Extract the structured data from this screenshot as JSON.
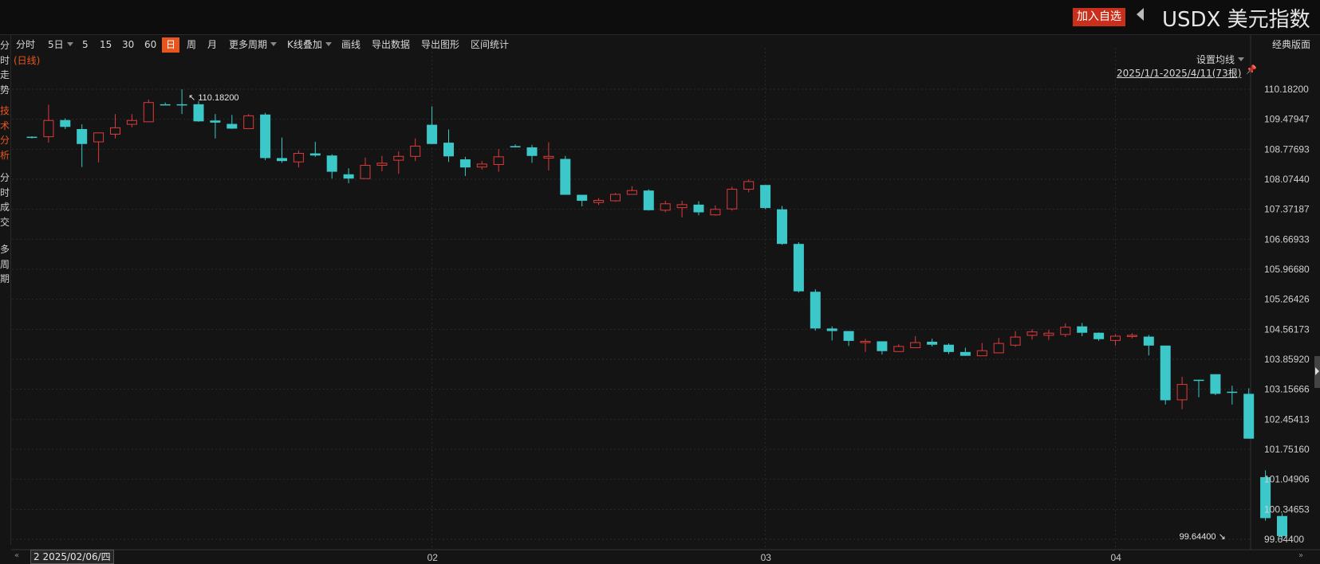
{
  "header": {
    "add_watchlist": "加入自选",
    "title": "USDX 美元指数"
  },
  "toolbar": {
    "items": [
      "分时",
      "5日",
      "5",
      "15",
      "30",
      "60",
      "日",
      "周",
      "月",
      "更多周期",
      "K线叠加",
      "画线",
      "导出数据",
      "导出图形",
      "区间统计"
    ],
    "active": "日",
    "classic_layout": "经典版面"
  },
  "sidebar": {
    "items": [
      "分时走势",
      "技术分析",
      "分时成交",
      "多周期"
    ],
    "active": "技术分析"
  },
  "chart_panel": {
    "period_label": "(日线)",
    "ma_setting": "设置均线",
    "date_range": "2025/1/1-2025/4/11(73根)",
    "date_tooltip": "2 2025/02/06/四",
    "nav_prev": "«",
    "nav_next": "»"
  },
  "colors": {
    "up": "#e03a3a",
    "down": "#3cc8c8",
    "grid": "#2b2b2b",
    "accent": "#e8561e",
    "background": "#141414"
  },
  "chart_data": {
    "type": "candlestick",
    "y_ticks": [
      "110.18200",
      "109.47947",
      "108.77693",
      "108.07440",
      "107.37187",
      "106.66933",
      "105.96680",
      "105.26426",
      "104.56173",
      "103.85920",
      "103.15666",
      "102.45413",
      "101.75160",
      "101.04906",
      "100.34653",
      "99.64400"
    ],
    "ylim": [
      99.644,
      110.182
    ],
    "x_labels": [
      {
        "index": 24,
        "label": "02"
      },
      {
        "index": 44,
        "label": "03"
      },
      {
        "index": 65,
        "label": "04"
      }
    ],
    "max_label": "110.18200",
    "max_index": 9,
    "min_label": "99.64400",
    "min_index": 72,
    "candles": [
      {
        "o": 109.07,
        "h": 109.08,
        "l": 109.03,
        "c": 109.05
      },
      {
        "o": 109.07,
        "h": 109.82,
        "l": 108.93,
        "c": 109.45
      },
      {
        "o": 109.46,
        "h": 109.5,
        "l": 109.25,
        "c": 109.3
      },
      {
        "o": 109.25,
        "h": 109.36,
        "l": 108.36,
        "c": 108.9
      },
      {
        "o": 108.95,
        "h": 109.11,
        "l": 108.47,
        "c": 109.16
      },
      {
        "o": 109.13,
        "h": 109.6,
        "l": 109.03,
        "c": 109.28
      },
      {
        "o": 109.36,
        "h": 109.6,
        "l": 109.29,
        "c": 109.45
      },
      {
        "o": 109.42,
        "h": 109.94,
        "l": 109.42,
        "c": 109.87
      },
      {
        "o": 109.83,
        "h": 109.87,
        "l": 109.83,
        "c": 109.83
      },
      {
        "o": 109.83,
        "h": 110.18,
        "l": 109.6,
        "c": 109.83
      },
      {
        "o": 109.83,
        "h": 109.9,
        "l": 109.42,
        "c": 109.43
      },
      {
        "o": 109.45,
        "h": 109.6,
        "l": 109.03,
        "c": 109.4
      },
      {
        "o": 109.37,
        "h": 109.58,
        "l": 109.25,
        "c": 109.26
      },
      {
        "o": 109.26,
        "h": 109.6,
        "l": 109.26,
        "c": 109.56
      },
      {
        "o": 109.59,
        "h": 109.63,
        "l": 108.52,
        "c": 108.57
      },
      {
        "o": 108.57,
        "h": 109.05,
        "l": 108.46,
        "c": 108.5
      },
      {
        "o": 108.48,
        "h": 108.75,
        "l": 108.35,
        "c": 108.68
      },
      {
        "o": 108.68,
        "h": 108.95,
        "l": 108.6,
        "c": 108.63
      },
      {
        "o": 108.63,
        "h": 108.66,
        "l": 108.09,
        "c": 108.25
      },
      {
        "o": 108.19,
        "h": 108.33,
        "l": 107.98,
        "c": 108.09
      },
      {
        "o": 108.09,
        "h": 108.58,
        "l": 108.09,
        "c": 108.4
      },
      {
        "o": 108.4,
        "h": 108.62,
        "l": 108.26,
        "c": 108.45
      },
      {
        "o": 108.52,
        "h": 108.73,
        "l": 108.2,
        "c": 108.61
      },
      {
        "o": 108.61,
        "h": 109.03,
        "l": 108.5,
        "c": 108.85
      },
      {
        "o": 109.35,
        "h": 109.78,
        "l": 108.9,
        "c": 108.9
      },
      {
        "o": 108.93,
        "h": 109.24,
        "l": 108.48,
        "c": 108.61
      },
      {
        "o": 108.54,
        "h": 108.6,
        "l": 108.15,
        "c": 108.35
      },
      {
        "o": 108.36,
        "h": 108.5,
        "l": 108.3,
        "c": 108.43
      },
      {
        "o": 108.42,
        "h": 108.78,
        "l": 108.25,
        "c": 108.6
      },
      {
        "o": 108.85,
        "h": 108.89,
        "l": 108.82,
        "c": 108.82
      },
      {
        "o": 108.82,
        "h": 108.88,
        "l": 108.46,
        "c": 108.62
      },
      {
        "o": 108.57,
        "h": 108.94,
        "l": 108.28,
        "c": 108.61
      },
      {
        "o": 108.55,
        "h": 108.62,
        "l": 107.71,
        "c": 107.71
      },
      {
        "o": 107.71,
        "h": 107.71,
        "l": 107.44,
        "c": 107.57
      },
      {
        "o": 107.53,
        "h": 107.63,
        "l": 107.47,
        "c": 107.58
      },
      {
        "o": 107.57,
        "h": 107.75,
        "l": 107.55,
        "c": 107.72
      },
      {
        "o": 107.72,
        "h": 107.91,
        "l": 107.72,
        "c": 107.81
      },
      {
        "o": 107.81,
        "h": 107.84,
        "l": 107.34,
        "c": 107.35
      },
      {
        "o": 107.35,
        "h": 107.57,
        "l": 107.3,
        "c": 107.5
      },
      {
        "o": 107.41,
        "h": 107.57,
        "l": 107.18,
        "c": 107.48
      },
      {
        "o": 107.48,
        "h": 107.56,
        "l": 107.23,
        "c": 107.3
      },
      {
        "o": 107.24,
        "h": 107.46,
        "l": 107.22,
        "c": 107.37
      },
      {
        "o": 107.38,
        "h": 107.9,
        "l": 107.34,
        "c": 107.84
      },
      {
        "o": 107.84,
        "h": 108.07,
        "l": 107.77,
        "c": 108.02
      },
      {
        "o": 107.94,
        "h": 107.94,
        "l": 107.37,
        "c": 107.4
      },
      {
        "o": 107.37,
        "h": 107.45,
        "l": 106.54,
        "c": 106.56
      },
      {
        "o": 106.56,
        "h": 106.6,
        "l": 105.42,
        "c": 105.45
      },
      {
        "o": 105.44,
        "h": 105.5,
        "l": 104.53,
        "c": 104.58
      },
      {
        "o": 104.58,
        "h": 104.63,
        "l": 104.3,
        "c": 104.52
      },
      {
        "o": 104.52,
        "h": 104.52,
        "l": 104.17,
        "c": 104.29
      },
      {
        "o": 104.25,
        "h": 104.34,
        "l": 104.03,
        "c": 104.28
      },
      {
        "o": 104.28,
        "h": 104.28,
        "l": 103.97,
        "c": 104.05
      },
      {
        "o": 104.04,
        "h": 104.21,
        "l": 104.05,
        "c": 104.16
      },
      {
        "o": 104.13,
        "h": 104.4,
        "l": 104.13,
        "c": 104.25
      },
      {
        "o": 104.27,
        "h": 104.34,
        "l": 104.16,
        "c": 104.2
      },
      {
        "o": 104.2,
        "h": 104.23,
        "l": 103.98,
        "c": 104.03
      },
      {
        "o": 104.03,
        "h": 104.13,
        "l": 103.94,
        "c": 103.94
      },
      {
        "o": 103.94,
        "h": 104.24,
        "l": 103.94,
        "c": 104.06
      },
      {
        "o": 104.01,
        "h": 104.36,
        "l": 104.01,
        "c": 104.23
      },
      {
        "o": 104.19,
        "h": 104.52,
        "l": 104.15,
        "c": 104.38
      },
      {
        "o": 104.42,
        "h": 104.56,
        "l": 104.32,
        "c": 104.5
      },
      {
        "o": 104.42,
        "h": 104.55,
        "l": 104.31,
        "c": 104.47
      },
      {
        "o": 104.44,
        "h": 104.7,
        "l": 104.38,
        "c": 104.61
      },
      {
        "o": 104.63,
        "h": 104.71,
        "l": 104.4,
        "c": 104.48
      },
      {
        "o": 104.48,
        "h": 104.49,
        "l": 104.29,
        "c": 104.33
      },
      {
        "o": 104.3,
        "h": 104.45,
        "l": 104.18,
        "c": 104.4
      },
      {
        "o": 104.41,
        "h": 104.47,
        "l": 104.35,
        "c": 104.42
      },
      {
        "o": 104.39,
        "h": 104.43,
        "l": 103.95,
        "c": 104.18
      },
      {
        "o": 104.18,
        "h": 104.18,
        "l": 102.8,
        "c": 102.9
      },
      {
        "o": 102.91,
        "h": 103.45,
        "l": 102.69,
        "c": 103.27
      },
      {
        "o": 103.38,
        "h": 103.38,
        "l": 102.97,
        "c": 103.38
      },
      {
        "o": 103.51,
        "h": 103.51,
        "l": 103.02,
        "c": 103.05
      },
      {
        "o": 103.1,
        "h": 103.24,
        "l": 102.8,
        "c": 103.1
      },
      {
        "o": 103.05,
        "h": 103.18,
        "l": 102.0,
        "c": 102.0
      },
      {
        "o": 101.1,
        "h": 101.26,
        "l": 100.08,
        "c": 100.14
      },
      {
        "o": 100.19,
        "h": 100.25,
        "l": 99.64,
        "c": 99.72
      }
    ]
  }
}
